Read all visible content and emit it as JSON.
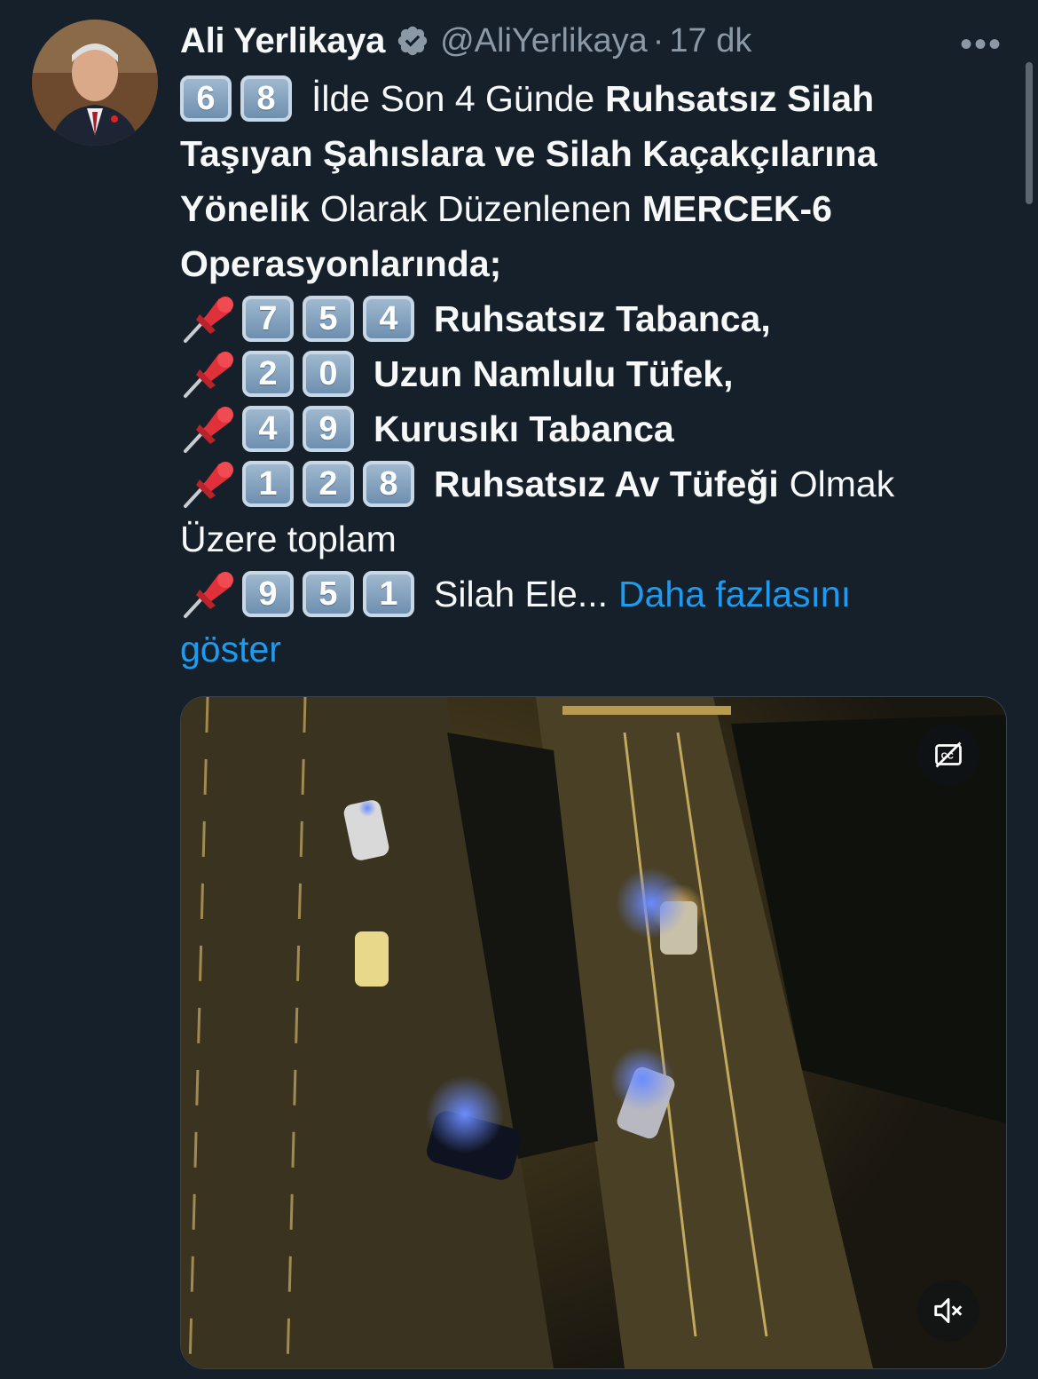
{
  "author": {
    "name": "Ali Yerlikaya",
    "handle": "@AliYerlikaya",
    "separator": "·",
    "time": "17 dk",
    "more": "•••"
  },
  "tweet": {
    "line1": {
      "keys": [
        "6",
        "8"
      ],
      "normal": "İlde Son 4 Günde",
      "bold": "Ruhsatsız Silah"
    },
    "line2": {
      "bold": "Taşıyan Şahıslara ve Silah Kaçakçılarına"
    },
    "line3": {
      "bold1": "Yönelik",
      "normal": "Olarak Düzenlenen",
      "bold2": "MERCEK-6"
    },
    "line4": {
      "bold": "Operasyonlarında;"
    },
    "items": [
      {
        "keys": [
          "7",
          "5",
          "4"
        ],
        "bold": "Ruhsatsız Tabanca,",
        "normal": ""
      },
      {
        "keys": [
          "2",
          "0"
        ],
        "bold": "Uzun Namlulu Tüfek,",
        "normal": ""
      },
      {
        "keys": [
          "4",
          "9"
        ],
        "bold": "Kurusıkı Tabanca",
        "normal": ""
      },
      {
        "keys": [
          "1",
          "2",
          "8"
        ],
        "bold": "Ruhsatsız Av Tüfeği",
        "normal": "Olmak"
      }
    ],
    "line9": {
      "normal": "Üzere toplam"
    },
    "line10": {
      "keys": [
        "9",
        "5",
        "1"
      ],
      "normal": "Silah Ele...",
      "link": "Daha fazlasını"
    },
    "line11": {
      "link": "göster"
    }
  },
  "colors": {
    "accent": "#1d9bf0",
    "background": "#15202b",
    "muted": "#8b98a5"
  },
  "icons": {
    "verified": "verified-badge-icon",
    "pin": "pushpin-icon",
    "cc": "closed-captions-off-icon",
    "mute": "speaker-muted-icon"
  }
}
